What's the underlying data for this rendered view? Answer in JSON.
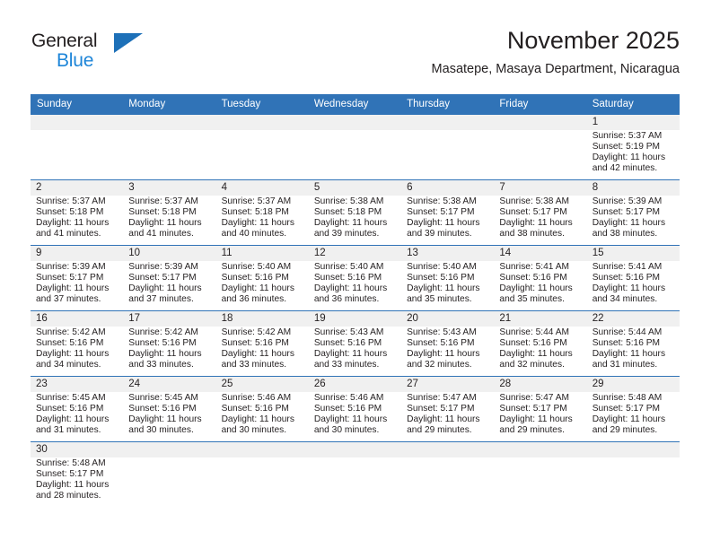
{
  "brand": {
    "name_top": "General",
    "name_bottom": "Blue",
    "triangle_color": "#1d70b8",
    "blue_text_color": "#1d85d8",
    "logo_icon": "general-blue-logo-icon"
  },
  "header": {
    "title": "November 2025",
    "subtitle": "Masatepe, Masaya Department, Nicaragua"
  },
  "theme": {
    "header_blue": "#3073b7",
    "daynum_band": "#f0f0f0",
    "text": "#231f20"
  },
  "weekdays": [
    "Sunday",
    "Monday",
    "Tuesday",
    "Wednesday",
    "Thursday",
    "Friday",
    "Saturday"
  ],
  "weeks": [
    [
      {
        "day": "",
        "empty": true
      },
      {
        "day": "",
        "empty": true
      },
      {
        "day": "",
        "empty": true
      },
      {
        "day": "",
        "empty": true
      },
      {
        "day": "",
        "empty": true
      },
      {
        "day": "",
        "empty": true
      },
      {
        "day": "1",
        "sunrise": "Sunrise: 5:37 AM",
        "sunset": "Sunset: 5:19 PM",
        "daylight_1": "Daylight: 11 hours",
        "daylight_2": "and 42 minutes."
      }
    ],
    [
      {
        "day": "2",
        "sunrise": "Sunrise: 5:37 AM",
        "sunset": "Sunset: 5:18 PM",
        "daylight_1": "Daylight: 11 hours",
        "daylight_2": "and 41 minutes."
      },
      {
        "day": "3",
        "sunrise": "Sunrise: 5:37 AM",
        "sunset": "Sunset: 5:18 PM",
        "daylight_1": "Daylight: 11 hours",
        "daylight_2": "and 41 minutes."
      },
      {
        "day": "4",
        "sunrise": "Sunrise: 5:37 AM",
        "sunset": "Sunset: 5:18 PM",
        "daylight_1": "Daylight: 11 hours",
        "daylight_2": "and 40 minutes."
      },
      {
        "day": "5",
        "sunrise": "Sunrise: 5:38 AM",
        "sunset": "Sunset: 5:18 PM",
        "daylight_1": "Daylight: 11 hours",
        "daylight_2": "and 39 minutes."
      },
      {
        "day": "6",
        "sunrise": "Sunrise: 5:38 AM",
        "sunset": "Sunset: 5:17 PM",
        "daylight_1": "Daylight: 11 hours",
        "daylight_2": "and 39 minutes."
      },
      {
        "day": "7",
        "sunrise": "Sunrise: 5:38 AM",
        "sunset": "Sunset: 5:17 PM",
        "daylight_1": "Daylight: 11 hours",
        "daylight_2": "and 38 minutes."
      },
      {
        "day": "8",
        "sunrise": "Sunrise: 5:39 AM",
        "sunset": "Sunset: 5:17 PM",
        "daylight_1": "Daylight: 11 hours",
        "daylight_2": "and 38 minutes."
      }
    ],
    [
      {
        "day": "9",
        "sunrise": "Sunrise: 5:39 AM",
        "sunset": "Sunset: 5:17 PM",
        "daylight_1": "Daylight: 11 hours",
        "daylight_2": "and 37 minutes."
      },
      {
        "day": "10",
        "sunrise": "Sunrise: 5:39 AM",
        "sunset": "Sunset: 5:17 PM",
        "daylight_1": "Daylight: 11 hours",
        "daylight_2": "and 37 minutes."
      },
      {
        "day": "11",
        "sunrise": "Sunrise: 5:40 AM",
        "sunset": "Sunset: 5:16 PM",
        "daylight_1": "Daylight: 11 hours",
        "daylight_2": "and 36 minutes."
      },
      {
        "day": "12",
        "sunrise": "Sunrise: 5:40 AM",
        "sunset": "Sunset: 5:16 PM",
        "daylight_1": "Daylight: 11 hours",
        "daylight_2": "and 36 minutes."
      },
      {
        "day": "13",
        "sunrise": "Sunrise: 5:40 AM",
        "sunset": "Sunset: 5:16 PM",
        "daylight_1": "Daylight: 11 hours",
        "daylight_2": "and 35 minutes."
      },
      {
        "day": "14",
        "sunrise": "Sunrise: 5:41 AM",
        "sunset": "Sunset: 5:16 PM",
        "daylight_1": "Daylight: 11 hours",
        "daylight_2": "and 35 minutes."
      },
      {
        "day": "15",
        "sunrise": "Sunrise: 5:41 AM",
        "sunset": "Sunset: 5:16 PM",
        "daylight_1": "Daylight: 11 hours",
        "daylight_2": "and 34 minutes."
      }
    ],
    [
      {
        "day": "16",
        "sunrise": "Sunrise: 5:42 AM",
        "sunset": "Sunset: 5:16 PM",
        "daylight_1": "Daylight: 11 hours",
        "daylight_2": "and 34 minutes."
      },
      {
        "day": "17",
        "sunrise": "Sunrise: 5:42 AM",
        "sunset": "Sunset: 5:16 PM",
        "daylight_1": "Daylight: 11 hours",
        "daylight_2": "and 33 minutes."
      },
      {
        "day": "18",
        "sunrise": "Sunrise: 5:42 AM",
        "sunset": "Sunset: 5:16 PM",
        "daylight_1": "Daylight: 11 hours",
        "daylight_2": "and 33 minutes."
      },
      {
        "day": "19",
        "sunrise": "Sunrise: 5:43 AM",
        "sunset": "Sunset: 5:16 PM",
        "daylight_1": "Daylight: 11 hours",
        "daylight_2": "and 33 minutes."
      },
      {
        "day": "20",
        "sunrise": "Sunrise: 5:43 AM",
        "sunset": "Sunset: 5:16 PM",
        "daylight_1": "Daylight: 11 hours",
        "daylight_2": "and 32 minutes."
      },
      {
        "day": "21",
        "sunrise": "Sunrise: 5:44 AM",
        "sunset": "Sunset: 5:16 PM",
        "daylight_1": "Daylight: 11 hours",
        "daylight_2": "and 32 minutes."
      },
      {
        "day": "22",
        "sunrise": "Sunrise: 5:44 AM",
        "sunset": "Sunset: 5:16 PM",
        "daylight_1": "Daylight: 11 hours",
        "daylight_2": "and 31 minutes."
      }
    ],
    [
      {
        "day": "23",
        "sunrise": "Sunrise: 5:45 AM",
        "sunset": "Sunset: 5:16 PM",
        "daylight_1": "Daylight: 11 hours",
        "daylight_2": "and 31 minutes."
      },
      {
        "day": "24",
        "sunrise": "Sunrise: 5:45 AM",
        "sunset": "Sunset: 5:16 PM",
        "daylight_1": "Daylight: 11 hours",
        "daylight_2": "and 30 minutes."
      },
      {
        "day": "25",
        "sunrise": "Sunrise: 5:46 AM",
        "sunset": "Sunset: 5:16 PM",
        "daylight_1": "Daylight: 11 hours",
        "daylight_2": "and 30 minutes."
      },
      {
        "day": "26",
        "sunrise": "Sunrise: 5:46 AM",
        "sunset": "Sunset: 5:16 PM",
        "daylight_1": "Daylight: 11 hours",
        "daylight_2": "and 30 minutes."
      },
      {
        "day": "27",
        "sunrise": "Sunrise: 5:47 AM",
        "sunset": "Sunset: 5:17 PM",
        "daylight_1": "Daylight: 11 hours",
        "daylight_2": "and 29 minutes."
      },
      {
        "day": "28",
        "sunrise": "Sunrise: 5:47 AM",
        "sunset": "Sunset: 5:17 PM",
        "daylight_1": "Daylight: 11 hours",
        "daylight_2": "and 29 minutes."
      },
      {
        "day": "29",
        "sunrise": "Sunrise: 5:48 AM",
        "sunset": "Sunset: 5:17 PM",
        "daylight_1": "Daylight: 11 hours",
        "daylight_2": "and 29 minutes."
      }
    ],
    [
      {
        "day": "30",
        "sunrise": "Sunrise: 5:48 AM",
        "sunset": "Sunset: 5:17 PM",
        "daylight_1": "Daylight: 11 hours",
        "daylight_2": "and 28 minutes."
      },
      {
        "day": "",
        "empty": true
      },
      {
        "day": "",
        "empty": true
      },
      {
        "day": "",
        "empty": true
      },
      {
        "day": "",
        "empty": true
      },
      {
        "day": "",
        "empty": true
      },
      {
        "day": "",
        "empty": true
      }
    ]
  ]
}
